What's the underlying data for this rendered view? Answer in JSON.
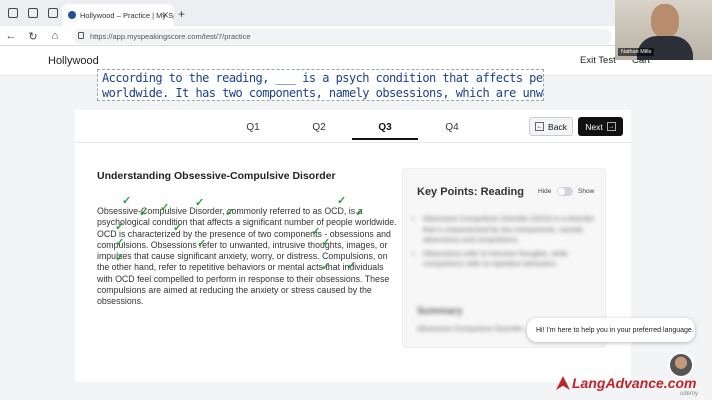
{
  "browser": {
    "tab_title": "Hollywood – Practice | My Speaki…",
    "tab_close": "✕",
    "new_tab": "+",
    "url": "https://app.myspeakingscore.com/test/7/practice",
    "nav_back": "←",
    "nav_reload": "↻",
    "nav_home": "⌂"
  },
  "header": {
    "brand": "Hollywood",
    "exit_label": "Exit Test",
    "cart_label": "Cart"
  },
  "video": {
    "name_tag": "Nathan Mills"
  },
  "subtitle": {
    "line1": "According to the reading, ___ is a psych condition that affects people",
    "line2": "worldwide. It has two components, namely obsessions, which are unwa"
  },
  "questions": {
    "tabs": [
      "Q1",
      "Q2",
      "Q3",
      "Q4"
    ],
    "active": "Q3",
    "back_label": "Back",
    "next_label": "Next",
    "back_arrow": "←",
    "next_arrow": "→"
  },
  "passage": {
    "title": "Understanding Obsessive-Compulsive Disorder",
    "text": "Obsessive-Compulsive Disorder, commonly referred to as OCD, is a psychological condition that affects a significant number of people worldwide. OCD is characterized by the presence of two components - obsessions and compulsions. Obsessions refer to unwanted, intrusive thoughts, images, or impulses that cause significant anxiety, worry, or distress. Compulsions, on the other hand, refer to repetitive behaviors or mental acts that individuals with OCD feel compelled to perform in response to their obsessions. These compulsions are aimed at reducing the anxiety or stress caused by the obsessions.",
    "check_mark": "✓"
  },
  "key_points": {
    "title": "Key Points: Reading",
    "hide_label": "Hide",
    "show_label": "Show",
    "items": [
      "Obsessive-Compulsive Disorder (OCD) is a disorder that is characterized by two components, namely obsessions and compulsions.",
      "Obsessions refer to intrusive thoughts, while compulsions refer to repetitive behaviors."
    ],
    "summary_title": "Summary",
    "summary_text": "Obsessive-Compulsive Disorder..."
  },
  "chat": {
    "message": "Hi! I'm here to help you in your preferred language."
  },
  "logo": {
    "part1": "Lang",
    "part2": "Advance.com"
  },
  "watermark": "udemy"
}
